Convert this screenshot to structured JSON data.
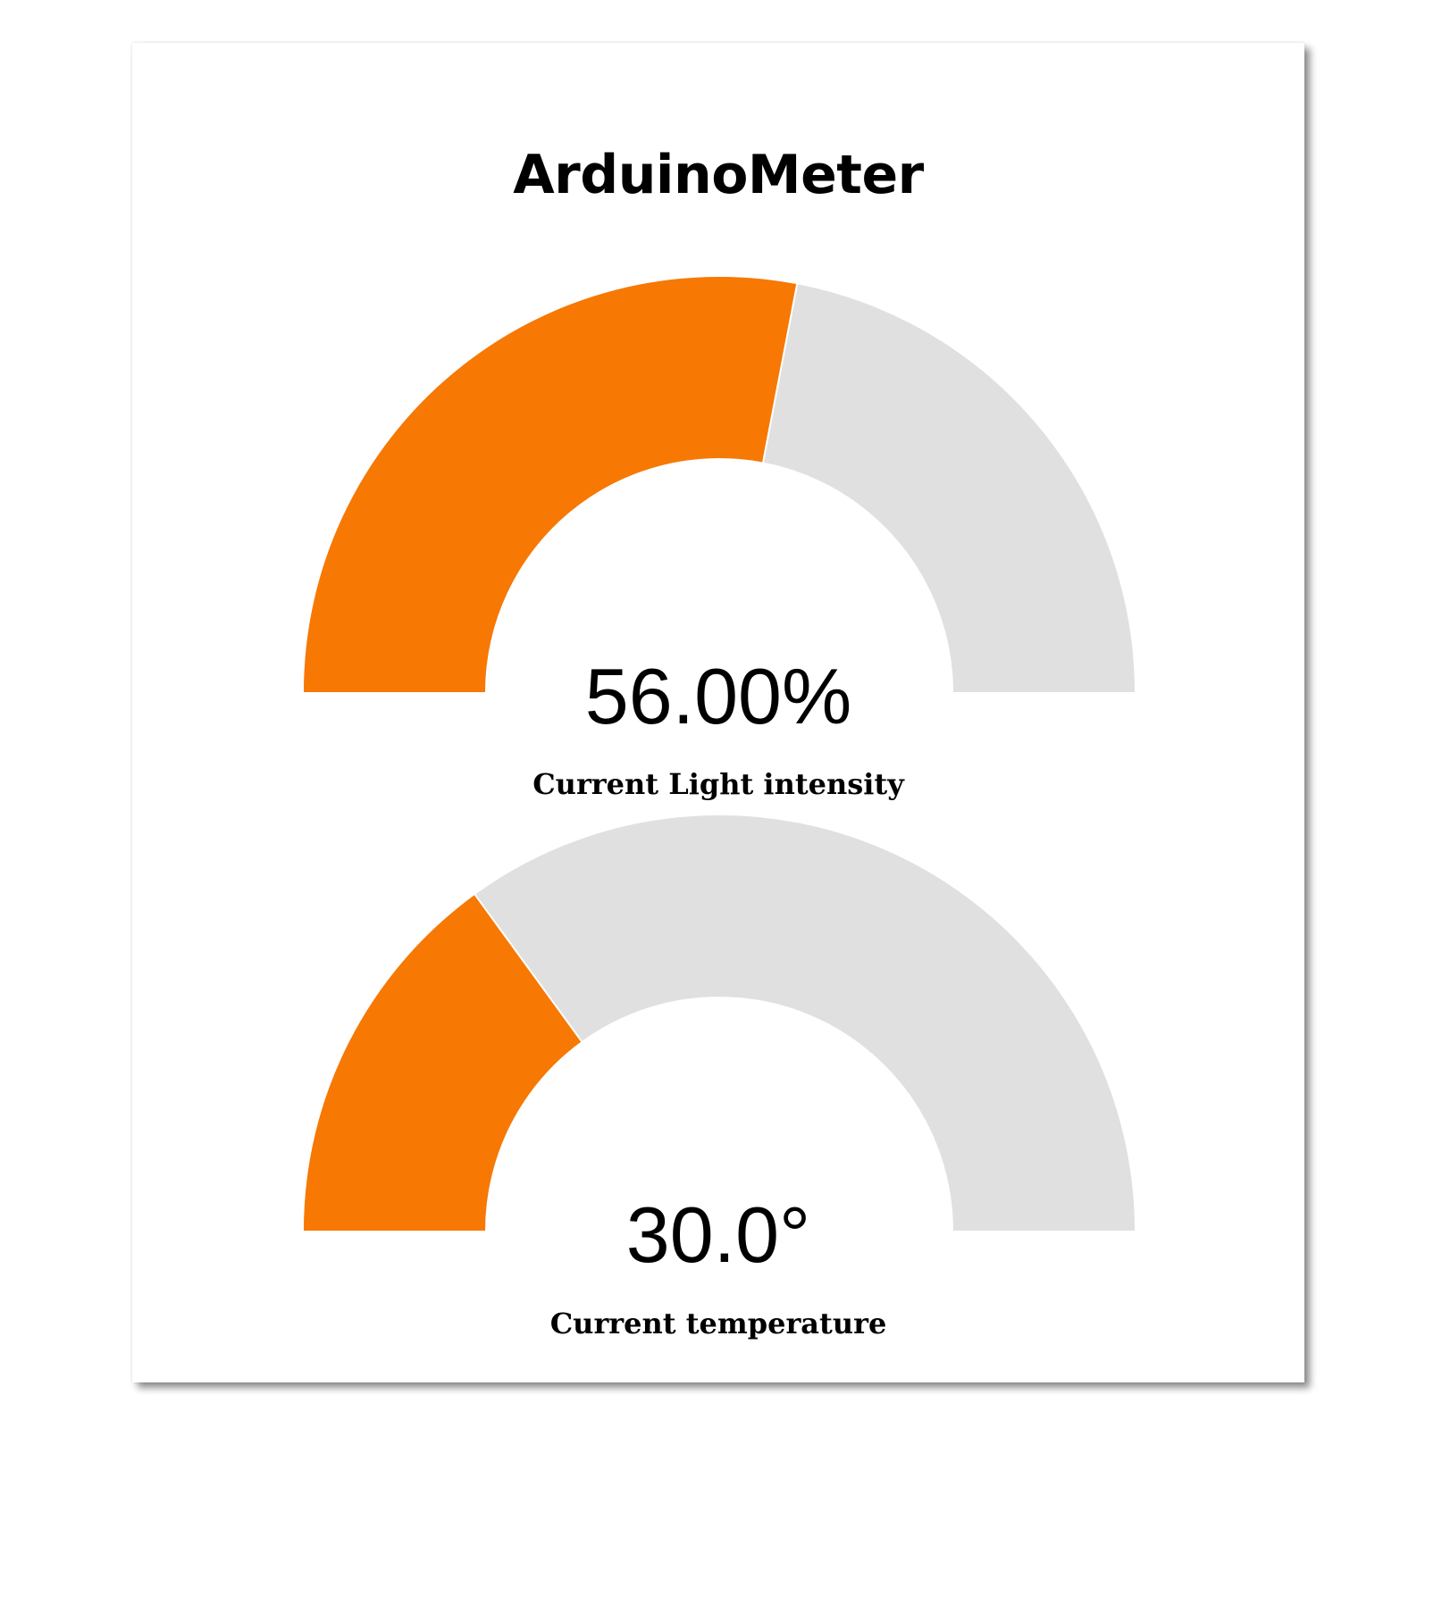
{
  "app": {
    "title": "ArduinoMeter"
  },
  "gauges": [
    {
      "value_text": "56.00%",
      "label": "Current Light intensity",
      "fill_fraction": 0.56
    },
    {
      "value_text": "30.0°",
      "label": "Current temperature",
      "fill_fraction": 0.3
    }
  ],
  "colors": {
    "fill": "#F77803",
    "track": "#E0E0E0",
    "separator": "#FFFFFF"
  }
}
